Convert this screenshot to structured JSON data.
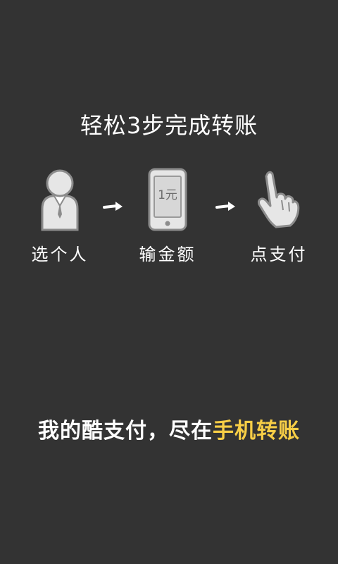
{
  "guide": {
    "title": "轻松3步完成转账",
    "steps": [
      {
        "label": "选个人",
        "icon": "person-icon"
      },
      {
        "label": "输金额",
        "icon": "phone-icon",
        "amount_text": "1元"
      },
      {
        "label": "点支付",
        "icon": "tap-hand-icon"
      }
    ],
    "arrows": [
      "arrow-right-icon",
      "arrow-right-icon"
    ],
    "slogan": {
      "text": "我的酷支付，尽在",
      "highlight": "手机转账"
    }
  },
  "colors": {
    "background": "#333333",
    "text": "#ffffff",
    "icon_fill": "#e6e6e6",
    "icon_stroke": "#8c8c8c",
    "highlight": "#f7ce46"
  }
}
